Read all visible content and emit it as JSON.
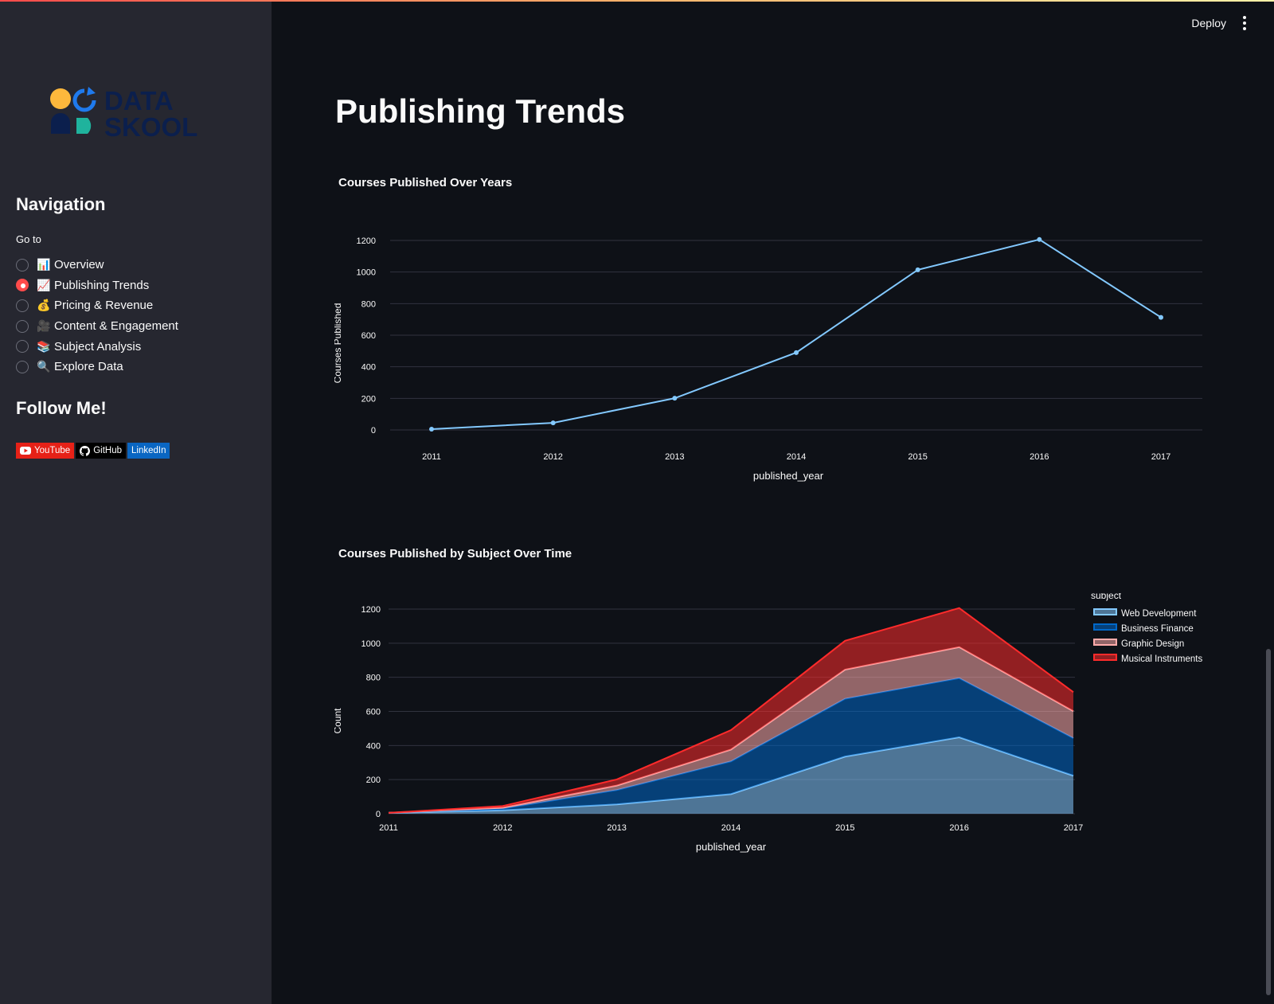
{
  "sidebar": {
    "logo": {
      "line1": "DATA",
      "line2": "SKOOL"
    },
    "nav_title": "Navigation",
    "goto_label": "Go to",
    "nav_items": [
      {
        "emoji": "📊",
        "label": "Overview",
        "selected": false
      },
      {
        "emoji": "📈",
        "label": "Publishing Trends",
        "selected": true
      },
      {
        "emoji": "💰",
        "label": "Pricing & Revenue",
        "selected": false
      },
      {
        "emoji": "🎥",
        "label": "Content & Engagement",
        "selected": false
      },
      {
        "emoji": "📚",
        "label": "Subject Analysis",
        "selected": false
      },
      {
        "emoji": "🔍",
        "label": "Explore Data",
        "selected": false
      }
    ],
    "follow_title": "Follow Me!",
    "badges": [
      {
        "label": "YouTube",
        "icon": "youtube-icon"
      },
      {
        "label": "GitHub",
        "icon": "github-icon"
      },
      {
        "label": "LinkedIn",
        "icon": ""
      }
    ]
  },
  "header": {
    "deploy_label": "Deploy",
    "menu_icon": "kebab-menu-icon"
  },
  "main": {
    "page_title": "Publishing Trends"
  },
  "colors": {
    "accent": "#ff4b4b",
    "line": "#83c9ff",
    "web_dev": "#83c9ff",
    "business_finance": "#0068c9",
    "graphic_design": "#ffabab",
    "musical_instruments": "#ff2b2b"
  },
  "chart_data": [
    {
      "type": "line",
      "title": "Courses Published Over Years",
      "xlabel": "published_year",
      "ylabel": "Courses Published",
      "x": [
        2011,
        2012,
        2013,
        2014,
        2015,
        2016,
        2017
      ],
      "y": [
        5,
        45,
        201,
        490,
        1014,
        1206,
        713
      ],
      "ylim": [
        0,
        1200
      ],
      "yticks": [
        0,
        200,
        400,
        600,
        800,
        1000,
        1200
      ],
      "grid": true
    },
    {
      "type": "area",
      "title": "Courses Published by Subject Over Time",
      "xlabel": "published_year",
      "ylabel": "Count",
      "x": [
        2011,
        2012,
        2013,
        2014,
        2015,
        2016,
        2017
      ],
      "ylim": [
        0,
        1200
      ],
      "yticks": [
        0,
        200,
        400,
        600,
        800,
        1000,
        1200
      ],
      "stacked": true,
      "legend_title": "subject",
      "legend_position": "top-right",
      "series": [
        {
          "name": "Web Development",
          "values": [
            5,
            20,
            55,
            115,
            335,
            448,
            223
          ]
        },
        {
          "name": "Business Finance",
          "values": [
            0,
            10,
            84,
            192,
            339,
            347,
            220
          ]
        },
        {
          "name": "Graphic Design",
          "values": [
            0,
            5,
            26,
            69,
            171,
            182,
            158
          ]
        },
        {
          "name": "Musical Instruments",
          "values": [
            0,
            10,
            36,
            114,
            169,
            229,
            112
          ]
        }
      ]
    }
  ]
}
